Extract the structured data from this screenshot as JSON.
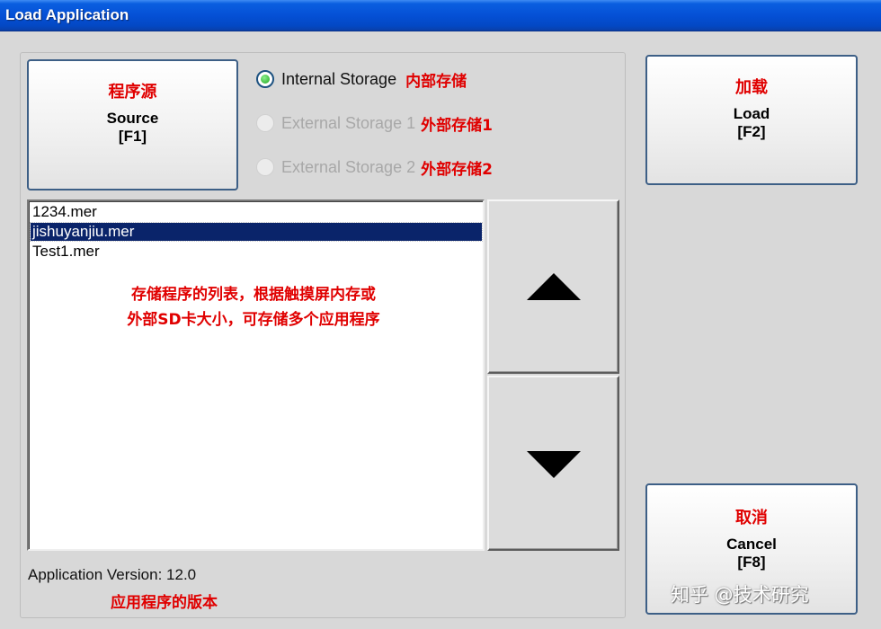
{
  "window": {
    "title": "Load Application"
  },
  "source_button": {
    "annotation": "程序源",
    "label": "Source",
    "key": "[F1]"
  },
  "load_button": {
    "annotation": "加载",
    "label": "Load",
    "key": "[F2]"
  },
  "cancel_button": {
    "annotation": "取消",
    "label": "Cancel",
    "key": "[F8]"
  },
  "storage_options": [
    {
      "label": "Internal Storage",
      "annotation": "内部存储",
      "checked": true,
      "enabled": true
    },
    {
      "label": "External Storage 1",
      "annotation": "外部存储1",
      "checked": false,
      "enabled": false
    },
    {
      "label": "External Storage 2",
      "annotation": "外部存储2",
      "checked": false,
      "enabled": false
    }
  ],
  "file_list": {
    "items": [
      "1234.mer",
      "jishuyanjiu.mer",
      "Test1.mer"
    ],
    "selected_index": 1,
    "annotation_line1": "存储程序的列表，根据触摸屏内存或",
    "annotation_line2": "外部SD卡大小，可存储多个应用程序"
  },
  "version": {
    "text": "Application Version: 12.0",
    "annotation": "应用程序的版本"
  },
  "credit": "知乎 @技术研究",
  "colors": {
    "titlebar": "#0550d6",
    "annotation": "#e00000",
    "selection": "#0a246a"
  }
}
